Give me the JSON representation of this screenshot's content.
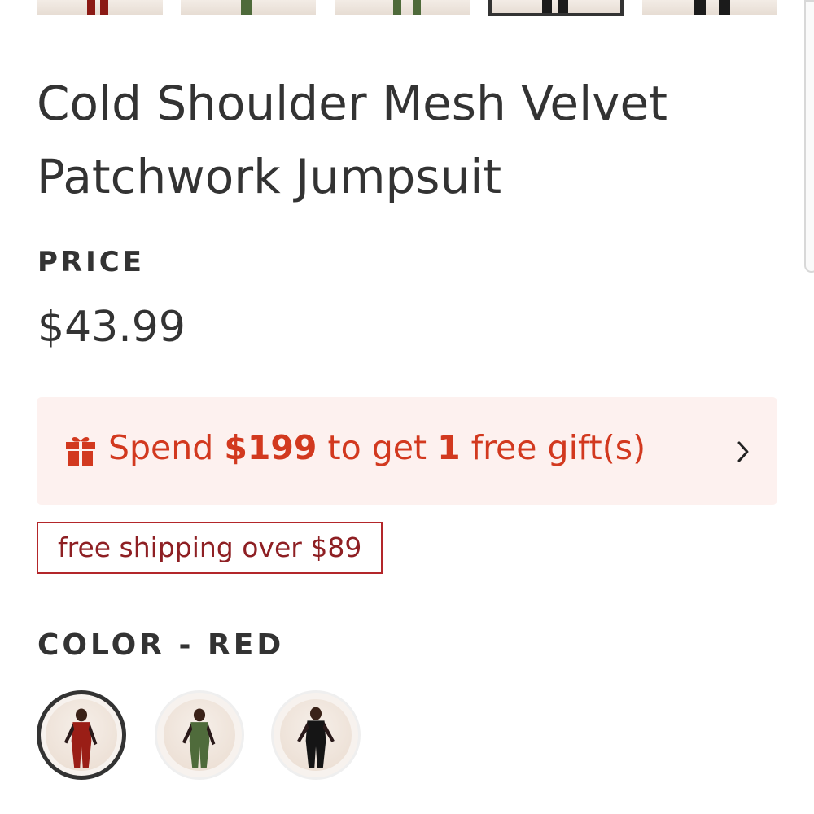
{
  "thumbnails": [
    {
      "name": "red",
      "color": "#8b1a15"
    },
    {
      "name": "green",
      "color": "#4e6a3a"
    },
    {
      "name": "green",
      "color": "#4e6a3a"
    },
    {
      "name": "black",
      "color": "#1b1b1b",
      "selected": true
    },
    {
      "name": "black",
      "color": "#1b1b1b"
    }
  ],
  "product": {
    "title": "Cold Shoulder Mesh Velvet Patchwork Jumpsuit"
  },
  "price": {
    "label": "PRICE",
    "value": "$43.99"
  },
  "gift_banner": {
    "icon": "gift-icon",
    "text_spend": "Spend",
    "amount": "$199",
    "text_to_get": "to get",
    "count": "1",
    "text_gift": "free gift(s)",
    "accent_color": "#d2391f",
    "background": "#fdf1ef"
  },
  "shipping_badge": {
    "text": "free shipping over $89",
    "border_color": "#b3262a"
  },
  "color_selector": {
    "label": "COLOR - RED",
    "options": [
      {
        "name": "red",
        "color": "#9a1e16",
        "selected": true
      },
      {
        "name": "green",
        "color": "#4f6b3b",
        "selected": false
      },
      {
        "name": "black",
        "color": "#151515",
        "selected": false
      }
    ]
  }
}
